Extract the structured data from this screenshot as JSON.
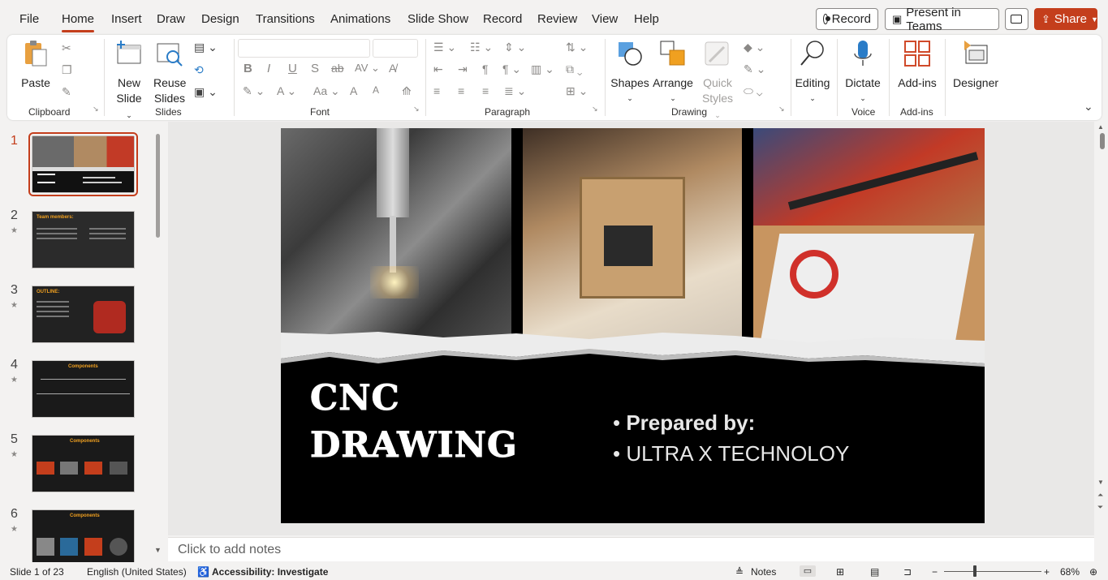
{
  "tabs": [
    "File",
    "Home",
    "Insert",
    "Draw",
    "Design",
    "Transitions",
    "Animations",
    "Slide Show",
    "Record",
    "Review",
    "View",
    "Help"
  ],
  "top_buttons": {
    "record": "Record",
    "present": "Present in Teams",
    "share": "Share"
  },
  "ribbon": {
    "clipboard": {
      "paste": "Paste",
      "label": "Clipboard"
    },
    "slides": {
      "new_slide_1": "New",
      "new_slide_2": "Slide",
      "reuse_1": "Reuse",
      "reuse_2": "Slides",
      "label": "Slides"
    },
    "font": {
      "label": "Font"
    },
    "paragraph": {
      "label": "Paragraph"
    },
    "drawing": {
      "shapes": "Shapes",
      "arrange": "Arrange",
      "quick_1": "Quick",
      "quick_2": "Styles",
      "label": "Drawing"
    },
    "editing": {
      "label": "Editing"
    },
    "voice": {
      "dictate": "Dictate",
      "label": "Voice"
    },
    "addins": {
      "addins": "Add-ins",
      "label": "Add-ins"
    },
    "designer": {
      "label": "Designer"
    }
  },
  "thumbnails": [
    {
      "num": "1",
      "star": ""
    },
    {
      "num": "2",
      "star": "★",
      "title": "Team members:"
    },
    {
      "num": "3",
      "star": "★",
      "title": "OUTLINE:"
    },
    {
      "num": "4",
      "star": "★",
      "title": "Components"
    },
    {
      "num": "5",
      "star": "★",
      "title": "Components"
    },
    {
      "num": "6",
      "star": "★",
      "title": "Components"
    }
  ],
  "slide": {
    "title_line1": "CNC",
    "title_line2": "DRAWING",
    "bullet1": "Prepared by:",
    "bullet2": "ULTRA X TECHNOLOY"
  },
  "notes_placeholder": "Click to add notes",
  "status": {
    "slide_info": "Slide 1 of 23",
    "language": "English (United States)",
    "accessibility": "Accessibility: Investigate",
    "notes": "Notes",
    "zoom": "68%"
  },
  "colors": {
    "accent": "#c43e1c",
    "slide_bg": "#000000"
  }
}
